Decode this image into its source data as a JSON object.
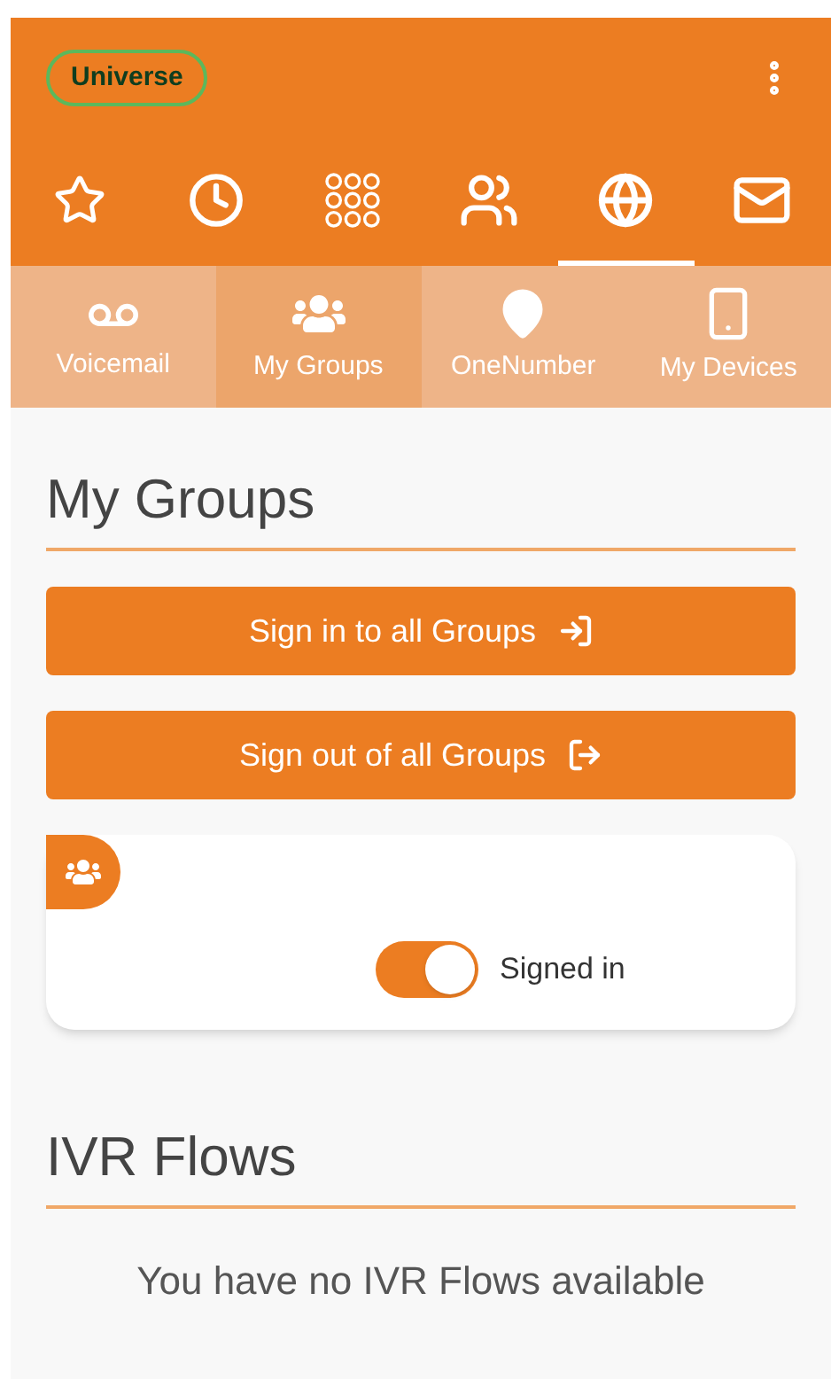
{
  "header": {
    "badge": "Universe"
  },
  "main_tabs": [
    {
      "kind": "star",
      "selected": false
    },
    {
      "kind": "clock",
      "selected": false
    },
    {
      "kind": "dialpad",
      "selected": false
    },
    {
      "kind": "contacts",
      "selected": false
    },
    {
      "kind": "globe",
      "selected": true
    },
    {
      "kind": "mail",
      "selected": false
    }
  ],
  "sub_tabs": [
    {
      "kind": "voicemail",
      "label": "Voicemail",
      "selected": false
    },
    {
      "kind": "groups",
      "label": "My Groups",
      "selected": true
    },
    {
      "kind": "pin",
      "label": "OneNumber",
      "selected": false
    },
    {
      "kind": "phone",
      "label": "My Devices",
      "selected": false
    }
  ],
  "groups_section": {
    "title": "My Groups",
    "buttons": [
      {
        "kind": "sign-in",
        "label": "Sign in to all Groups"
      },
      {
        "kind": "sign-out",
        "label": "Sign out of all Groups"
      }
    ],
    "group_card": {
      "toggle": {
        "on": true,
        "label": "Signed in"
      }
    }
  },
  "ivr_section": {
    "title": "IVR Flows",
    "empty_text": "You have no IVR Flows available"
  }
}
